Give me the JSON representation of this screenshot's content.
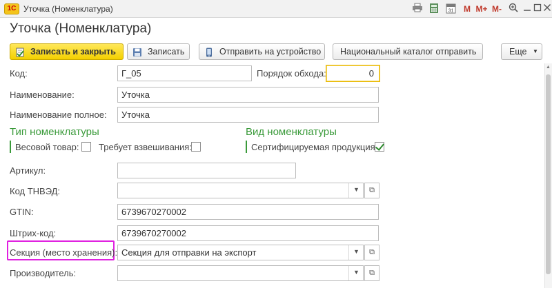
{
  "window": {
    "logo": "1С",
    "title": "Уточка (Номенклатура)",
    "icons": [
      "print-icon",
      "calculator-icon",
      "calendar-icon",
      "memory-icon",
      "memory-plus-icon",
      "memory-minus-icon",
      "zoom-icon",
      "minimize-icon",
      "maximize-icon",
      "close-icon"
    ],
    "memory_labels": [
      "M",
      "M+",
      "M-"
    ]
  },
  "form": {
    "title": "Уточка (Номенклатура)"
  },
  "toolbar": {
    "save_close": "Записать и закрыть",
    "save": "Записать",
    "send_device": "Отправить на устройство",
    "national_catalog": "Национальный каталог отправить",
    "more": "Еще"
  },
  "fields": {
    "code": {
      "label": "Код:",
      "value": "Г_05"
    },
    "order": {
      "label": "Порядок обхода:",
      "value": "0"
    },
    "name": {
      "label": "Наименование:",
      "value": "Уточка"
    },
    "full_name": {
      "label": "Наименование полное:",
      "value": "Уточка"
    },
    "article": {
      "label": "Артикул:",
      "value": ""
    },
    "tnved": {
      "label": "Код ТНВЭД:",
      "value": ""
    },
    "gtin": {
      "label": "GTIN:",
      "value": "6739670270002"
    },
    "barcode": {
      "label": "Штрих-код:",
      "value": "6739670270002"
    },
    "section": {
      "label": "Секция (место хранения):",
      "value": "Секция для отправки на экспорт"
    },
    "manufacturer": {
      "label": "Производитель:",
      "value": ""
    }
  },
  "nomenclature_type": {
    "title": "Тип номенклатуры",
    "weight_label": "Весовой товар:",
    "weight_checked": false,
    "weighing_label": "Требует взвешивания:",
    "weighing_checked": false
  },
  "nomenclature_kind": {
    "title": "Вид номенклатуры",
    "certified_label": "Сертифицируемая продукция:",
    "certified_checked": true
  },
  "colors": {
    "accent_yellow": "#f4d000",
    "section_green": "#3a9a3a",
    "highlight_magenta": "#e020e0"
  }
}
